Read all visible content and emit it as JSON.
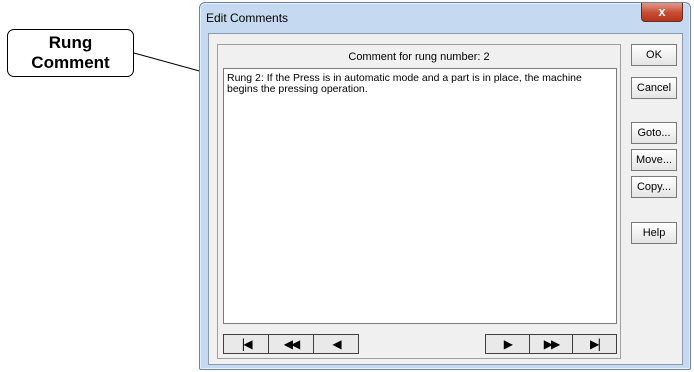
{
  "callout": {
    "line1": "Rung",
    "line2": "Comment"
  },
  "window": {
    "title": "Edit Comments",
    "close_glyph": "x"
  },
  "comment": {
    "label": "Comment for rung number: 2",
    "text": "Rung 2: If the Press is in automatic mode and a part is in place, the machine begins the pressing operation."
  },
  "nav": {
    "first": "|◀",
    "prev_fast": "◀◀",
    "prev": "◀",
    "next": "▶",
    "next_fast": "▶▶",
    "last": "▶|"
  },
  "buttons": {
    "ok": "OK",
    "cancel": "Cancel",
    "goto": "Goto...",
    "move": "Move...",
    "copy": "Copy...",
    "help": "Help"
  }
}
